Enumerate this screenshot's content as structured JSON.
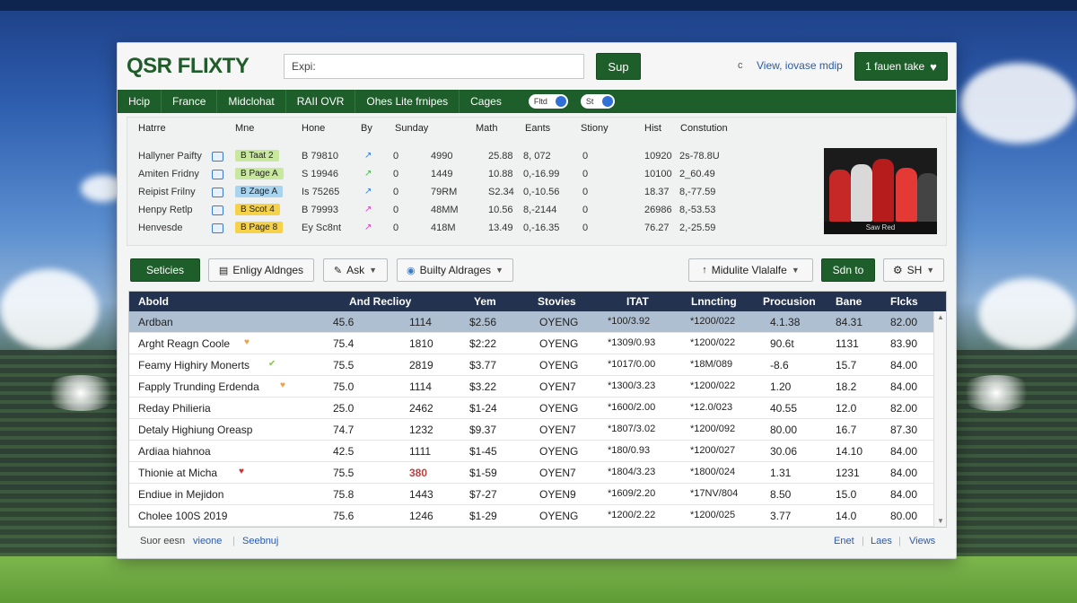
{
  "colors": {
    "brand_green": "#1e5e2a",
    "table_header": "#23324f",
    "selected_row": "#aebfd2",
    "link": "#2a5aa8"
  },
  "header": {
    "logo": "QSR FLIXTY",
    "search_value": "Expi:",
    "search_button": "Sup",
    "divider": "c",
    "view_link": "View, iovase mdip",
    "take_button": "1 fauen take",
    "take_icon": "heart-icon"
  },
  "nav": {
    "items": [
      "Hcip",
      "France",
      "Midclohat",
      "RAII OVR",
      "Ohes Lite frnipes",
      "Cages"
    ],
    "toggle_1": "Fltd",
    "toggle_2": "St"
  },
  "panel": {
    "headers": [
      "Hatrre",
      "Mne",
      "Hone",
      "By",
      "Sunday",
      "Math",
      "Eants",
      "Stiony",
      "Hist",
      "Constution"
    ],
    "rows": [
      {
        "name": "Hallyner Paifty",
        "tag": "B Taat 2",
        "tag_color": "#c8e8a0",
        "hone": "B 79810",
        "icon_color": "#3a7bc8",
        "by": "0",
        "sunday": "4990",
        "math": "25.88",
        "eants": "8, 072",
        "stiony": "0",
        "hist": "10920",
        "const": "2s-78.8U"
      },
      {
        "name": "Amiten Fridny",
        "tag": "B Page A",
        "tag_color": "#c8e8a0",
        "hone": "S 19946",
        "icon_color": "#4caf50",
        "by": "0",
        "sunday": "1449",
        "math": "10.88",
        "eants": "0,-16.99",
        "stiony": "0",
        "hist": "10100",
        "const": "2_60.49"
      },
      {
        "name": "Reipist Frilny",
        "tag": "B Zage A",
        "tag_color": "#a8d4f0",
        "hone": "Is 75265",
        "icon_color": "#3a7bc8",
        "by": "0",
        "sunday": "79RM",
        "math": "S2.34",
        "eants": "0,-10.56",
        "stiony": "0",
        "hist": "18.37",
        "const": "8,-77.59"
      },
      {
        "name": "Henpy Retlp",
        "tag": "B Scot 4",
        "tag_color": "#f5d24a",
        "hone": "B 79993",
        "icon_color": "#c44ab8",
        "by": "0",
        "sunday": "48MM",
        "math": "10.56",
        "eants": "8,-2144",
        "stiony": "0",
        "hist": "26986",
        "const": "8,-53.53"
      },
      {
        "name": "Henvesde",
        "tag": "B Page 8",
        "tag_color": "#f5d24a",
        "hone": "Ey Sc8nt",
        "icon_color": "#c44ab8",
        "by": "0",
        "sunday": "418M",
        "math": "13.49",
        "eants": "0,-16.35",
        "stiony": "0",
        "hist": "76.27",
        "const": "2,-25.59"
      }
    ],
    "photo_caption": "Saw Red"
  },
  "toolbar": {
    "setcies": "Seticies",
    "enligy": "Enligy Aldnges",
    "ask": "Ask",
    "builty": "Builty Aldrages",
    "midulte": "Midulite Vlalalfe",
    "sdn": "Sdn to",
    "sh": "SH"
  },
  "table": {
    "headers": [
      "Abold",
      "And Reclioy",
      "Yem",
      "Stovies",
      "ITAT",
      "Lnncting",
      "Procusion",
      "Bane",
      "Flcks"
    ],
    "rows": [
      {
        "name": "Ardban",
        "icon": "",
        "c1": "45.6",
        "c2": "1114",
        "c3": "$2.56",
        "c4": "OYENG",
        "c5": "*100/3.92",
        "c6": "*1200/022",
        "c7": "4.1.38",
        "c8": "84.31",
        "c9": "82.00",
        "selected": true
      },
      {
        "name": "Arght Reagn Coole",
        "icon": "heart-icon",
        "icon_color": "#f0a040",
        "c1": "75.4",
        "c2": "1810",
        "c3": "$2:22",
        "c4": "OYENG",
        "c5": "*1309/0.93",
        "c6": "*1200/022",
        "c7": "90.6t",
        "c8": "1131",
        "c9": "83.90",
        "selected": false
      },
      {
        "name": "Feamy Highiry Monerts",
        "icon": "chevron-icon",
        "icon_color": "#8bc34a",
        "c1": "75.5",
        "c2": "2819",
        "c3": "$3.77",
        "c4": "OYENG",
        "c5": "*1017/0.00",
        "c6": "*18M/089",
        "c7": "-8.6",
        "c8": "15.7",
        "c9": "84.00",
        "selected": false
      },
      {
        "name": "Fapply Trunding Erdenda",
        "icon": "heart-icon",
        "icon_color": "#f0a040",
        "c1": "75.0",
        "c2": "1114",
        "c3": "$3.22",
        "c4": "OYEN7",
        "c5": "*1300/3.23",
        "c6": "*1200/022",
        "c7": "1.20",
        "c8": "18.2",
        "c9": "84.00",
        "selected": false
      },
      {
        "name": "Reday Philieria",
        "icon": "",
        "c1": "25.0",
        "c2": "2462",
        "c3": "$1-24",
        "c4": "OYENG",
        "c5": "*1600/2.00",
        "c6": "*12.0/023",
        "c7": "40.55",
        "c8": "12.0",
        "c9": "82.00",
        "selected": false
      },
      {
        "name": "Detaly Highiung Oreasp",
        "icon": "",
        "c1": "74.7",
        "c2": "1232",
        "c3": "$9.37",
        "c4": "OYEN7",
        "c5": "*1807/3.02",
        "c6": "*1200/092",
        "c7": "80.00",
        "c8": "16.7",
        "c9": "87.30",
        "selected": false
      },
      {
        "name": "Ardiaa hiahnoa",
        "icon": "",
        "c1": "42.5",
        "c2": "1111",
        "c3": "$1-45",
        "c4": "OYENG",
        "c5": "*180/0.93",
        "c6": "*1200/027",
        "c7": "30.06",
        "c8": "14.10",
        "c9": "84.00",
        "selected": false
      },
      {
        "name": "Thionie at Micha",
        "icon": "heart-icon",
        "icon_color": "#d03030",
        "c1": "75.5",
        "c2": "380",
        "c2_color": "#c04040",
        "c3": "$1-59",
        "c4": "OYEN7",
        "c5": "*1804/3.23",
        "c6": "*1800/024",
        "c7": "1.31",
        "c8": "1231",
        "c9": "84.00",
        "selected": false
      },
      {
        "name": "Endiue in Mejidon",
        "icon": "",
        "c1": "75.8",
        "c2": "1443",
        "c3": "$7-27",
        "c4": "OYEN9",
        "c5": "*1609/2.20",
        "c6": "*17NV/804",
        "c7": "8.50",
        "c8": "15.0",
        "c9": "84.00",
        "selected": false
      },
      {
        "name": "Cholee 100S 2019",
        "icon": "",
        "c1": "75.6",
        "c2": "1246",
        "c3": "$1-29",
        "c4": "OYENG",
        "c5": "*1200/2.22",
        "c6": "*1200/025",
        "c7": "3.77",
        "c8": "14.0",
        "c9": "80.00",
        "selected": false
      }
    ]
  },
  "footer": {
    "left_text": "Suor eesn",
    "left_link": "vieone",
    "mid_link": "Seebnuj",
    "right_links": [
      "Enet",
      "Laes",
      "Views"
    ]
  }
}
